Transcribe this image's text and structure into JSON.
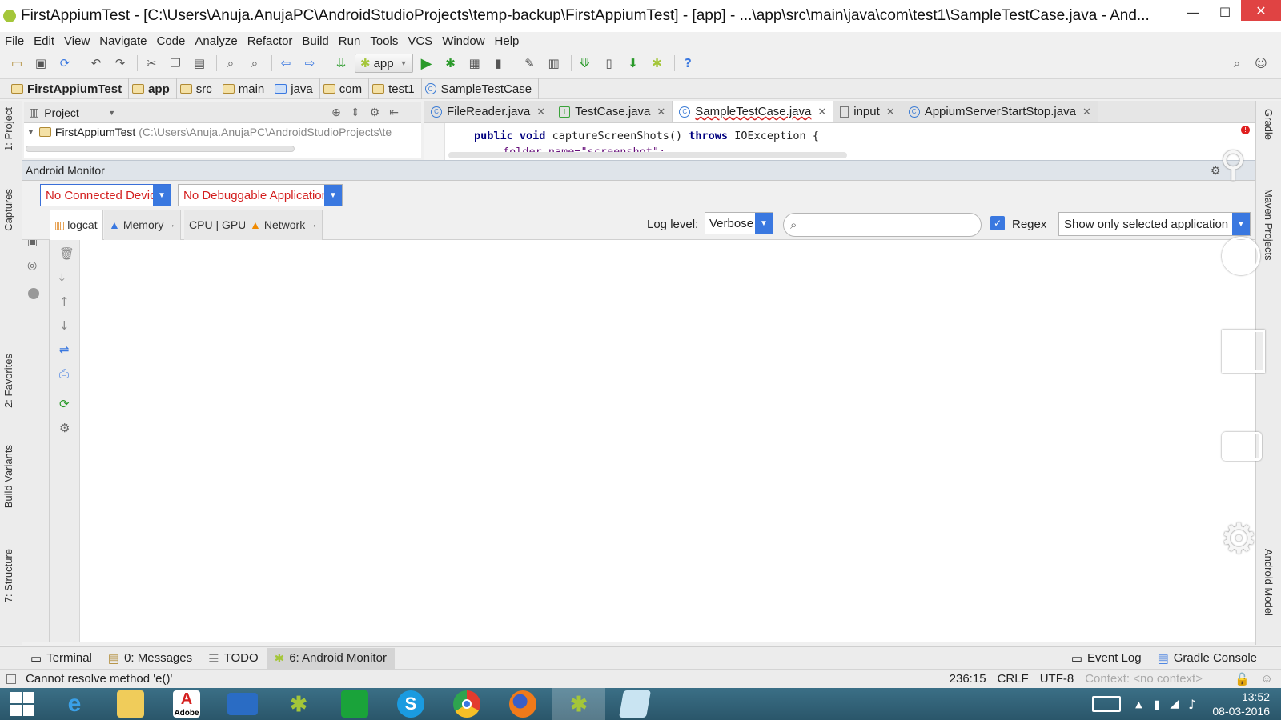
{
  "window": {
    "title": "FirstAppiumTest - [C:\\Users\\Anuja.AnujaPC\\AndroidStudioProjects\\temp-backup\\FirstAppiumTest] - [app] - ...\\app\\src\\main\\java\\com\\test1\\SampleTestCase.java - And...",
    "minimize": "—",
    "maximize": "☐",
    "close": "✕"
  },
  "menu": [
    "File",
    "Edit",
    "View",
    "Navigate",
    "Code",
    "Analyze",
    "Refactor",
    "Build",
    "Run",
    "Tools",
    "VCS",
    "Window",
    "Help"
  ],
  "toolbar": {
    "run_config": "app"
  },
  "breadcrumb": [
    "FirstAppiumTest",
    "app",
    "src",
    "main",
    "java",
    "com",
    "test1",
    "SampleTestCase"
  ],
  "left_strip": {
    "project": "1: Project",
    "captures": "Captures",
    "favorites": "2: Favorites",
    "build_variants": "Build Variants",
    "structure": "7: Structure"
  },
  "right_strip": {
    "gradle": "Gradle",
    "maven": "Maven Projects",
    "android_model": "Android Model"
  },
  "project_panel": {
    "view": "Project",
    "root": "FirstAppiumTest",
    "root_path": "(C:\\Users\\Anuja.AnujaPC\\AndroidStudioProjects\\te"
  },
  "editor_tabs": [
    {
      "label": "FileReader.java",
      "icon": "C",
      "active": false
    },
    {
      "label": "TestCase.java",
      "icon": "I",
      "active": false
    },
    {
      "label": "SampleTestCase.java",
      "icon": "C",
      "active": true
    },
    {
      "label": "input",
      "icon": "",
      "active": false
    },
    {
      "label": "AppiumServerStartStop.java",
      "icon": "C",
      "active": false
    }
  ],
  "code": {
    "line1_kw1": "public",
    "line1_kw2": "void",
    "line1_name": "captureScreenShots()",
    "line1_kw3": "throws",
    "line1_rest": "IOException {",
    "line2": "folder_name=\"screenshot\";"
  },
  "monitor": {
    "title": "Android Monitor",
    "device_combo": "No Connected Devices",
    "app_combo": "No Debuggable Applications",
    "tabs": [
      "logcat",
      "Memory",
      "CPU | GPU",
      "Network"
    ],
    "log_level_label": "Log level:",
    "log_level": "Verbose",
    "search_placeholder": "",
    "regex_label": "Regex",
    "filter": "Show only selected application"
  },
  "bottom_tabs": {
    "terminal": "Terminal",
    "messages": "0: Messages",
    "todo": "TODO",
    "android_monitor": "6: Android Monitor",
    "event_log": "Event Log",
    "gradle_console": "Gradle Console"
  },
  "status": {
    "message": "Cannot resolve method 'e()'",
    "position": "236:15",
    "line_sep": "CRLF",
    "encoding": "UTF-8",
    "context": "Context: <no context>"
  },
  "taskbar": {
    "apps": [
      "windows-start",
      "internet-explorer",
      "file-explorer",
      "adobe",
      "lenovo",
      "android-studio",
      "store",
      "skype",
      "chrome",
      "firefox",
      "android-studio-active",
      "notepad"
    ],
    "adobe_label": "Adobe",
    "time": "13:52",
    "date": "08-03-2016"
  },
  "colors": {
    "accent": "#3a78e0",
    "error_text": "#d42020",
    "keyword": "#000080",
    "string": "#008000",
    "active_tab": "#ffffff"
  }
}
